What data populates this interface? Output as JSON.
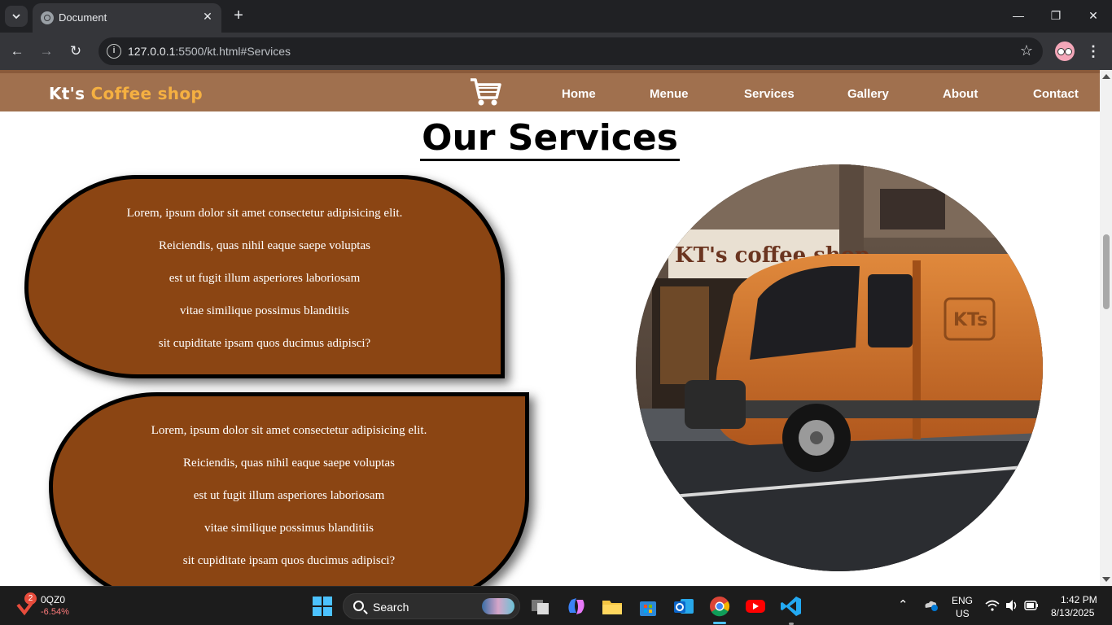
{
  "browser": {
    "tab_title": "Document",
    "url_host": "127.0.0.1",
    "url_path": ":5500/kt.html#Services"
  },
  "site": {
    "brand_first": "Kt's",
    "brand_accent": "Coffee shop",
    "nav": [
      "Home",
      "Menue",
      "Services",
      "Gallery",
      "About",
      "Contact"
    ],
    "heading": "Our Services",
    "cards": [
      [
        "Lorem, ipsum dolor sit amet consectetur adipisicing elit.",
        "Reiciendis, quas nihil eaque saepe voluptas",
        "est ut fugit illum asperiores laboriosam",
        "vitae similique possimus blanditiis",
        "sit cupiditate ipsam quos ducimus adipisci?"
      ],
      [
        "Lorem, ipsum dolor sit amet consectetur adipisicing elit.",
        "Reiciendis, quas nihil eaque saepe voluptas",
        "est ut fugit illum asperiores laboriosam",
        "vitae similique possimus blanditiis",
        "sit cupiditate ipsam quos ducimus adipisci?"
      ]
    ],
    "photo_sign": "KT's coffee shop",
    "van_logo": "KTs",
    "colors": {
      "nav": "#a0704e",
      "accent": "#f5b041",
      "card": "#8b4513"
    }
  },
  "taskbar": {
    "stock_badge": "2",
    "stock_name": "0QZ0",
    "stock_change": "-6.54%",
    "search_label": "Search",
    "lang": "ENG",
    "region": "US",
    "time": "1:42 PM",
    "date": "8/13/2025"
  }
}
